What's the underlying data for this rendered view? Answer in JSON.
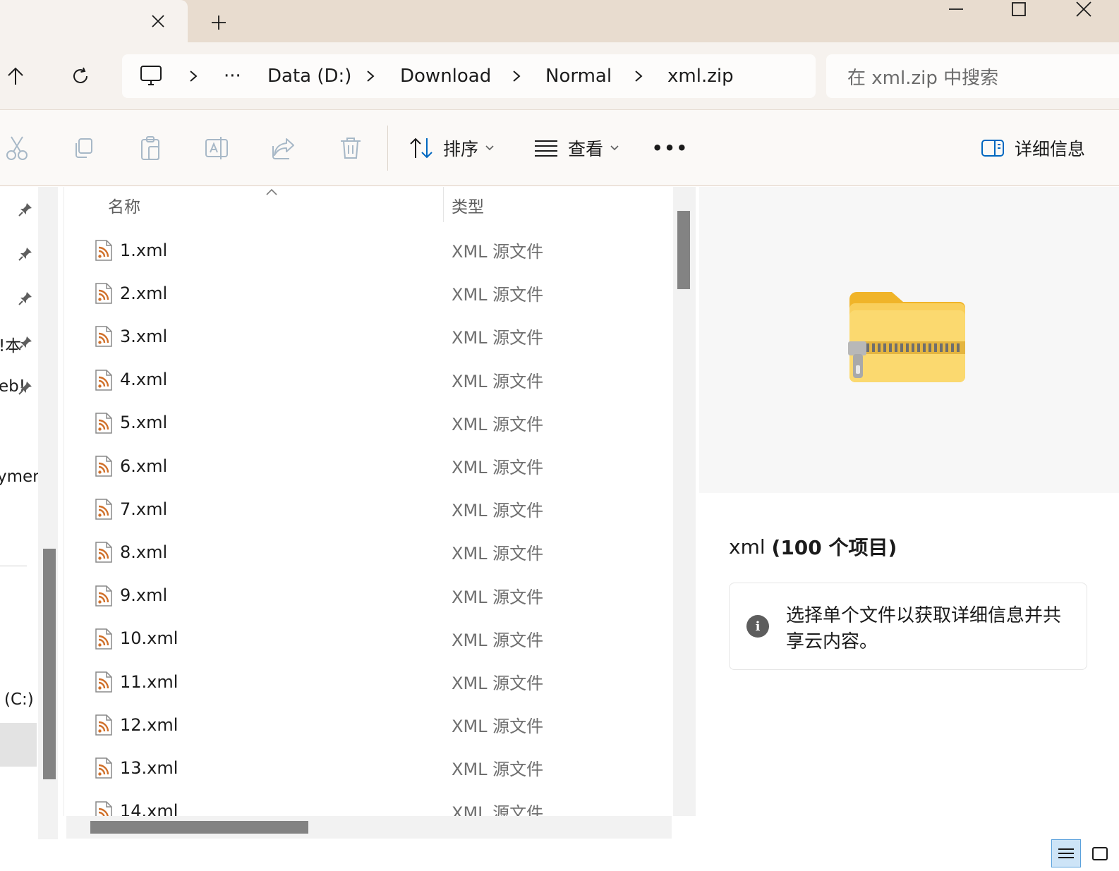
{
  "tab": {
    "title": ""
  },
  "address": {
    "overflow": "···",
    "crumbs": [
      "Data (D:)",
      "Download",
      "Normal",
      "xml.zip"
    ]
  },
  "search": {
    "placeholder": "在 xml.zip 中搜索"
  },
  "command_bar": {
    "sort_label": "排序",
    "view_label": "查看",
    "more_label": "•••",
    "details_label": "详细信息"
  },
  "nav_pane": {
    "items": [
      {
        "label": "",
        "pinned": true
      },
      {
        "label": "",
        "pinned": true
      },
      {
        "label": "",
        "pinned": true
      },
      {
        "label": "!本",
        "pinned": true
      },
      {
        "label": "eb!",
        "pinned": true
      },
      {
        "label": "ymen",
        "pinned": false
      },
      {
        "label": "(C:)",
        "pinned": false
      }
    ]
  },
  "file_list": {
    "columns": {
      "name": "名称",
      "type": "类型"
    },
    "rows": [
      {
        "name": "1.xml",
        "type": "XML 源文件"
      },
      {
        "name": "2.xml",
        "type": "XML 源文件"
      },
      {
        "name": "3.xml",
        "type": "XML 源文件"
      },
      {
        "name": "4.xml",
        "type": "XML 源文件"
      },
      {
        "name": "5.xml",
        "type": "XML 源文件"
      },
      {
        "name": "6.xml",
        "type": "XML 源文件"
      },
      {
        "name": "7.xml",
        "type": "XML 源文件"
      },
      {
        "name": "8.xml",
        "type": "XML 源文件"
      },
      {
        "name": "9.xml",
        "type": "XML 源文件"
      },
      {
        "name": "10.xml",
        "type": "XML 源文件"
      },
      {
        "name": "11.xml",
        "type": "XML 源文件"
      },
      {
        "name": "12.xml",
        "type": "XML 源文件"
      },
      {
        "name": "13.xml",
        "type": "XML 源文件"
      },
      {
        "name": "14.xml",
        "type": "XML 源文件"
      }
    ]
  },
  "details": {
    "title_name": "xml",
    "title_count": "(100 个项目)",
    "info_text": "选择单个文件以获取详细信息并共享云内容。"
  },
  "icons": {
    "file_icon": "xml-feed-icon",
    "preview_icon": "zip-folder-icon"
  },
  "colors": {
    "accent": "#0067c0",
    "feed_orange": "#d0702a",
    "folder_yellow": "#f7c948"
  }
}
